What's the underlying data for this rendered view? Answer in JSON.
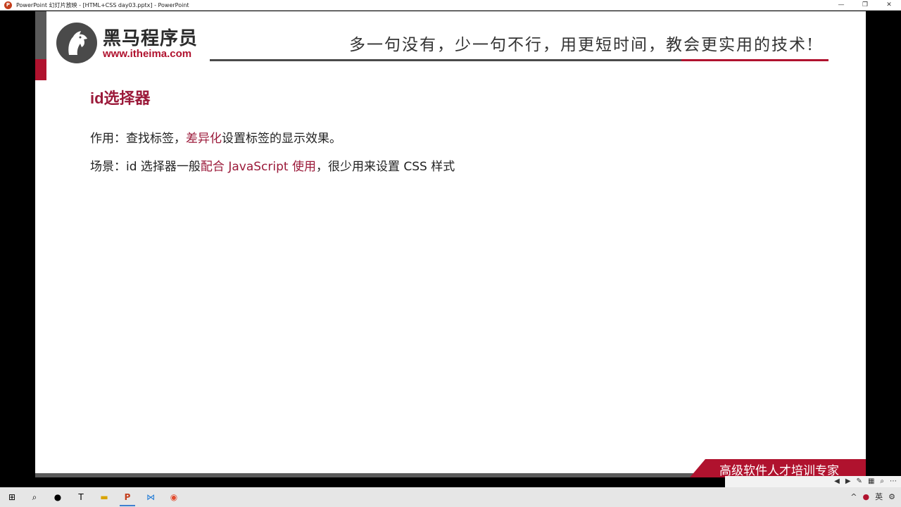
{
  "window": {
    "app_icon": "P",
    "title": "PowerPoint 幻灯片放映 - [HTML+CSS day03.pptx] - PowerPoint",
    "minimize": "—",
    "restore": "❐",
    "close": "✕"
  },
  "slide": {
    "logo": {
      "name": "黑马程序员",
      "url": "www.itheima.com"
    },
    "slogan": "多一句没有，少一句不行，用更短时间，教会更实用的技术!",
    "heading": "id选择器",
    "line1": {
      "label": "作用：查找标签，",
      "highlight": "差异化",
      "rest": "设置标签的显示效果。"
    },
    "line2": {
      "label": "场景：id 选择器一般",
      "highlight": "配合 JavaScript 使用",
      "rest": "，很少用来设置 CSS 样式"
    },
    "banner": "高级软件人才培训专家"
  },
  "presenter_toolbar": [
    "◀",
    "▶",
    "✎",
    "▦",
    "⌕",
    "⋯"
  ],
  "taskbar": {
    "start": "⊞",
    "search": "⌕",
    "apps": [
      "●",
      "T",
      "▬",
      "P",
      "⋈",
      "◉"
    ],
    "tray": [
      "^",
      "●",
      "英",
      "⚙"
    ]
  },
  "colors": {
    "accent": "#b0122e",
    "heading": "#9b1a3a",
    "dark": "#4a4a4a"
  }
}
